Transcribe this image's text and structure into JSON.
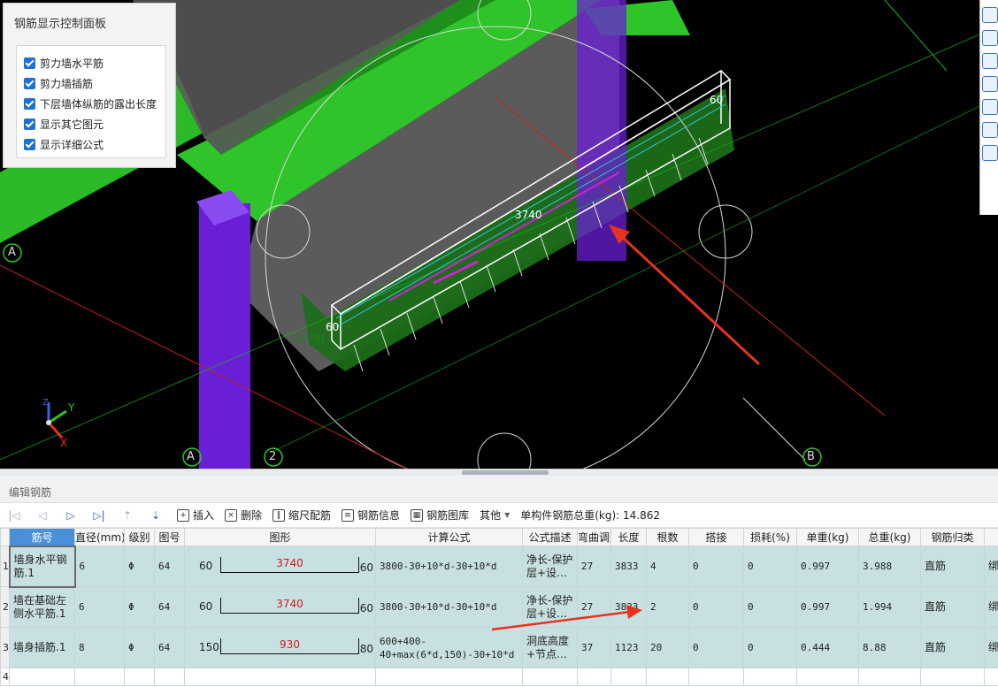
{
  "viewport": {
    "labels": {
      "dim_top": "60",
      "dim_mid": "3740",
      "dim_left": "60",
      "dim_faint": "(1070)",
      "axis_a_left": "A",
      "axis_a_bottom": "A",
      "axis_2": "2",
      "axis_b": "B",
      "gizmo_x": "X",
      "gizmo_y": "Y",
      "gizmo_z": "Z"
    }
  },
  "control_panel": {
    "title": "钢筋显示控制面板",
    "options": [
      {
        "label": "剪力墙水平筋",
        "checked": true
      },
      {
        "label": "剪力墙插筋",
        "checked": true
      },
      {
        "label": "下层墙体纵筋的露出长度",
        "checked": true
      },
      {
        "label": "显示其它图元",
        "checked": true
      },
      {
        "label": "显示详细公式",
        "checked": true
      }
    ]
  },
  "editor": {
    "title": "编辑钢筋",
    "toolbar": {
      "insert": "插入",
      "delete": "删除",
      "scale_rebar": "缩尺配筋",
      "rebar_info": "钢筋信息",
      "rebar_library": "钢筋图库",
      "other": "其他",
      "total_weight": "单构件钢筋总重(kg): 14.862"
    },
    "columns": [
      "筋号",
      "直径(mm)",
      "级别",
      "图号",
      "图形",
      "计算公式",
      "公式描述",
      "弯曲调整",
      "长度",
      "根数",
      "搭接",
      "损耗(%)",
      "单重(kg)",
      "总重(kg)",
      "钢筋归类",
      ""
    ],
    "rows": [
      {
        "num": "1",
        "name": "墙身水平钢筋.1",
        "dia": "6",
        "grade": "Φ",
        "fig": "64",
        "left": "60",
        "mid": "3740",
        "right": "60",
        "formula": "3800-30+10*d-30+10*d",
        "desc": "净长-保护层+设…",
        "bend": "27",
        "length": "3833",
        "count": "4",
        "lap": "0",
        "loss": "0",
        "unit_w": "0.997",
        "total_w": "3.988",
        "category": "直筋",
        "extra": "绑"
      },
      {
        "num": "2",
        "name": "墙在基础左侧水平筋.1",
        "dia": "6",
        "grade": "Φ",
        "fig": "64",
        "left": "60",
        "mid": "3740",
        "right": "60",
        "formula": "3800-30+10*d-30+10*d",
        "desc": "净长-保护层+设…",
        "bend": "27",
        "length": "3833",
        "count": "2",
        "lap": "0",
        "loss": "0",
        "unit_w": "0.997",
        "total_w": "1.994",
        "category": "直筋",
        "extra": "绑"
      },
      {
        "num": "3",
        "name": "墙身插筋.1",
        "dia": "8",
        "grade": "Φ",
        "fig": "64",
        "left": "150",
        "mid": "930",
        "right": "80",
        "formula": "600+400-40+max(6*d,150)-30+10*d",
        "desc": "洞底高度+节点…",
        "bend": "37",
        "length": "1123",
        "count": "20",
        "lap": "0",
        "loss": "0",
        "unit_w": "0.444",
        "total_w": "8.88",
        "category": "直筋",
        "extra": "绑"
      }
    ],
    "empty_row_num": "4"
  },
  "colors": {
    "beam_green": "#2fc42a",
    "column_purple": "#6a1fd6",
    "arrow_red": "#e8321f",
    "table_row": "#c8e0e1",
    "shape_value_red": "#d21a1a"
  }
}
